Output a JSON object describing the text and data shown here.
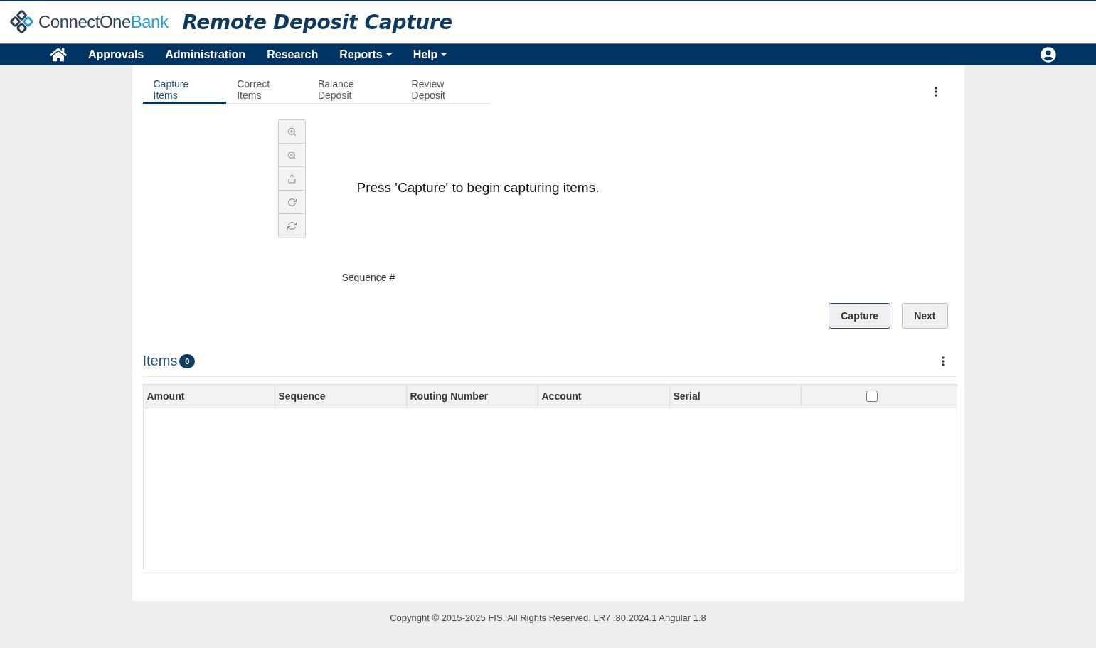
{
  "header": {
    "logo": {
      "part_1": "ConnectOne",
      "part_2": "Bank"
    },
    "title": "Remote Deposit Capture"
  },
  "nav": {
    "items": [
      {
        "label": "Approvals",
        "kind": "link"
      },
      {
        "label": "Administration",
        "kind": "link"
      },
      {
        "label": "Research",
        "kind": "link"
      },
      {
        "label": "Reports",
        "kind": "dropdown"
      },
      {
        "label": "Help",
        "kind": "dropdown"
      }
    ]
  },
  "tabs": [
    {
      "label": "Capture Items",
      "selected": true
    },
    {
      "label": "Correct Items",
      "selected": false
    },
    {
      "label": "Balance Deposit",
      "selected": false
    },
    {
      "label": "Review Deposit",
      "selected": false
    }
  ],
  "capture": {
    "message": "Press 'Capture' to begin capturing items.",
    "sequence_label": "Sequence #",
    "buttons": [
      {
        "label": "Capture",
        "selected": true
      },
      {
        "label": "Next",
        "selected": false
      }
    ]
  },
  "items": {
    "title": "Items",
    "count": "0",
    "columns": [
      "Amount",
      "Sequence",
      "Routing Number",
      "Account",
      "Serial"
    ],
    "select_all": {
      "checked": false
    }
  },
  "footer": "Copyright © 2015-2025 FIS. All Rights Reserved. LR7 .80.2024.1 Angular 1.8"
}
